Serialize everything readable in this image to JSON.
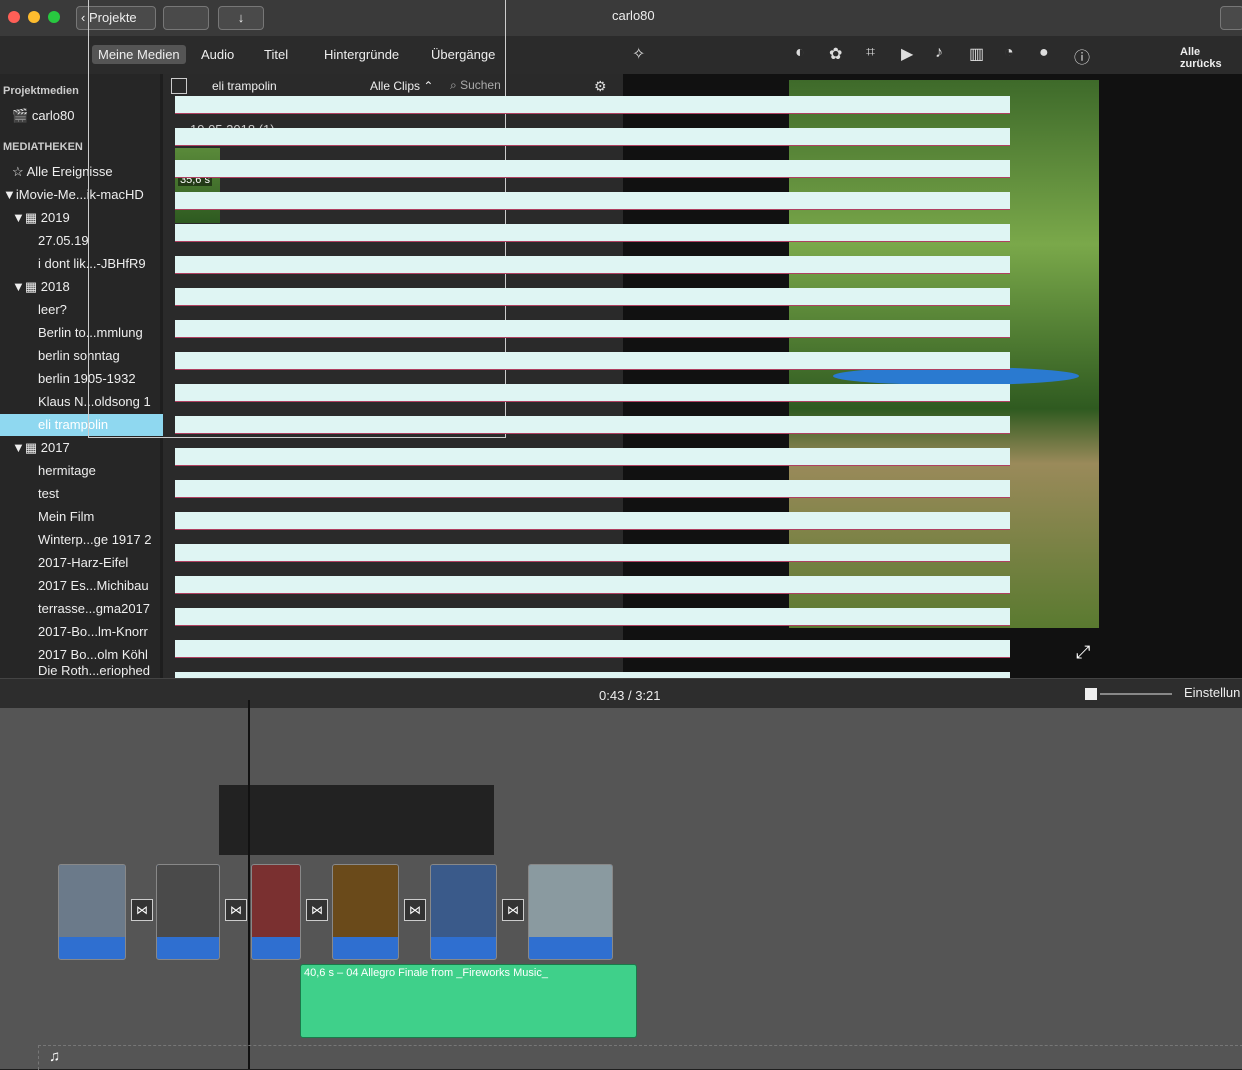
{
  "titlebar": {
    "back_label": "Projekte",
    "window_title": "carlo80",
    "reset_label": "Alle zurücks"
  },
  "tabs": [
    "Meine Medien",
    "Audio",
    "Titel",
    "Hintergründe",
    "Übergänge"
  ],
  "sidebar": {
    "project_header": "Projektmedien",
    "project_item": "carlo80",
    "libraries_header": "MEDIATHEKEN",
    "all_events": "Alle Ereignisse",
    "library": "iMovie-Me...ik-macHD",
    "groups": [
      {
        "year": "2019",
        "items": [
          "27.05.19",
          "i dont lik...-JBHfR9"
        ]
      },
      {
        "year": "2018",
        "items": [
          "leer?",
          "Berlin to...mmlung",
          "berlin sonntag",
          "berlin 1905-1932",
          "Klaus N...oldsong 1",
          "eli trampolin"
        ]
      },
      {
        "year": "2017",
        "items": [
          "hermitage",
          "test",
          "Mein Film",
          "Winterp...ge 1917 2",
          "2017-Harz-Eifel",
          "2017 Es...Michibau",
          "terrasse...gma2017",
          "2017-Bo...lm-Knorr",
          "2017 Bo...olm Köhl",
          "Die Roth...eriophed"
        ]
      }
    ],
    "selected": "eli trampolin"
  },
  "browser": {
    "event_name": "eli trampolin",
    "filter": "Alle Clips",
    "search_placeholder": "Suchen",
    "date_group": "19.05.2018  (1)",
    "clip_duration": "35,6 s"
  },
  "timeline": {
    "current_time": "0:43",
    "separator": "/",
    "total_time": "3:21",
    "settings_label": "Einstellun",
    "audio_clip_label": "40,6 s – 04 Allegro Finale from _Fireworks Music_"
  },
  "icons": [
    "magic-wand-icon",
    "color-balance-icon",
    "palette-icon",
    "crop-icon",
    "camera-icon",
    "volume-icon",
    "equalizer-icon",
    "speed-icon",
    "filters-icon",
    "info-icon",
    "settings-gear-icon",
    "fullscreen-icon",
    "music-note-icon"
  ]
}
